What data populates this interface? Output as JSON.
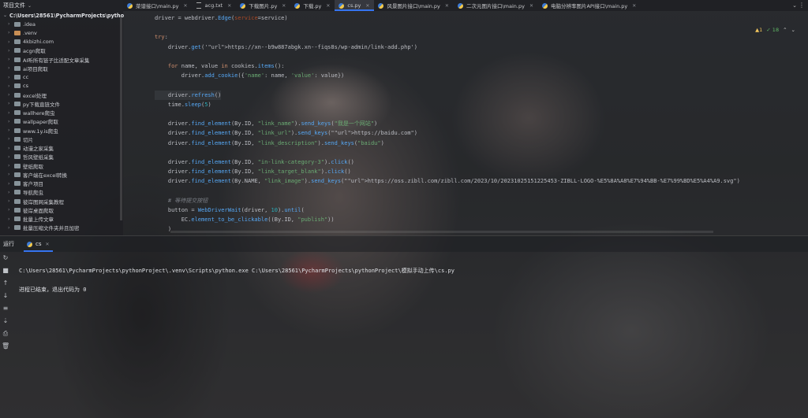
{
  "project": {
    "title": "项目文件",
    "root": "C:\\Users\\28561\\PycharmProjects\\pytho",
    "items": [
      {
        "label": ".idea"
      },
      {
        "label": ".venv"
      },
      {
        "label": "4kbizhi.com"
      },
      {
        "label": "acgn爬取"
      },
      {
        "label": "AI听所有链子比适配文章采集"
      },
      {
        "label": "ai项目爬取"
      },
      {
        "label": "cc"
      },
      {
        "label": "cs"
      },
      {
        "label": "excel处理"
      },
      {
        "label": "py下载直链文件"
      },
      {
        "label": "wallhere爬虫"
      },
      {
        "label": "wallpaper爬取"
      },
      {
        "label": "www.1y.is爬虫"
      },
      {
        "label": "切片"
      },
      {
        "label": "动漫之家采集"
      },
      {
        "label": "哲风壁纸采集"
      },
      {
        "label": "壁纸爬取"
      },
      {
        "label": "客户端在excel转换"
      },
      {
        "label": "客户项目"
      },
      {
        "label": "导航爬虫"
      },
      {
        "label": "彼岸图网采集教程"
      },
      {
        "label": "彼岸桌面爬取"
      },
      {
        "label": "批量上传文章"
      },
      {
        "label": "批量压缩文件夹并且加密"
      }
    ]
  },
  "tabs": [
    {
      "label": "菜谱接口\\main.py",
      "type": "py"
    },
    {
      "label": "acg.txt",
      "type": "txt"
    },
    {
      "label": "下载图片.py",
      "type": "py"
    },
    {
      "label": "下载.py",
      "type": "py"
    },
    {
      "label": "cs.py",
      "type": "py",
      "active": true
    },
    {
      "label": "风景图片接口\\main.py",
      "type": "py"
    },
    {
      "label": "二次元图片接口\\main.py",
      "type": "py"
    },
    {
      "label": "电脑分辨率图片API接口\\main.py",
      "type": "py"
    }
  ],
  "inspections": {
    "warnings": "▲1",
    "ok": "✓ 18"
  },
  "code_lines": [
    "driver = webdriver.Edge(service=service)",
    "",
    "try:",
    "    driver.get('https://xn--b9w887abgk.xn--fiqs8s/wp-admin/link-add.php')",
    "",
    "    for name, value in cookies.items():",
    "        driver.add_cookie({'name': name, 'value': value})",
    "",
    "    driver.refresh()",
    "    time.sleep(5)",
    "",
    "    driver.find_element(By.ID, \"link_name\").send_keys(\"我是一个网站\")",
    "    driver.find_element(By.ID, \"link_url\").send_keys(\"https://baidu.com\")",
    "    driver.find_element(By.ID, \"link_description\").send_keys(\"baidu\")",
    "",
    "    driver.find_element(By.ID, \"in-link-category-3\").click()",
    "    driver.find_element(By.ID, \"link_target_blank\").click()",
    "    driver.find_element(By.NAME, \"link_image\").send_keys(\"https://oss.zibll.com/zibll.com/2023/10/20231025151225453-ZIBLL-LOGO-%E5%8A%A8%E7%94%BB-%E7%99%BD%E5%A4%A9.svg\")",
    "",
    "    # 等待提交按钮",
    "    button = WebDriverWait(driver, 10).until(",
    "        EC.element_to_be_clickable((By.ID, \"publish\"))",
    "    )"
  ],
  "run": {
    "title": "运行",
    "tab": "cs",
    "console_lines": [
      "C:\\Users\\28561\\PycharmProjects\\pythonProject\\.venv\\Scripts\\python.exe C:\\Users\\28561\\PycharmProjects\\pythonProject\\模拟手动上传\\cs.py",
      "",
      "进程已结束，退出代码为 0"
    ]
  }
}
